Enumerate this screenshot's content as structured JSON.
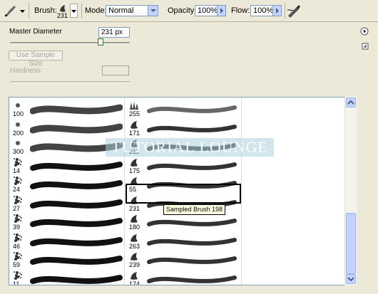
{
  "toolbar": {
    "tool_icon": "brush-tool-icon",
    "brush_label": "Brush:",
    "brush_size": "231",
    "mode_label": "Mode:",
    "mode_value": "Normal",
    "opacity_label": "Opacity:",
    "opacity_value": "100%",
    "flow_label": "Flow:",
    "flow_value": "100%",
    "airbrush_icon": "airbrush-icon"
  },
  "panel": {
    "master_diameter_label": "Master Diameter",
    "master_diameter_value": "231 px",
    "master_diameter_fraction": 0.78,
    "use_sample_size_label": "Use Sample Size",
    "hardness_label": "Hardness:",
    "menu_icon": "flyout-menu-icon",
    "new_preset_icon": "new-preset-icon"
  },
  "brushes": {
    "left_column": [
      {
        "num": "100",
        "tip": "soft"
      },
      {
        "num": "200",
        "tip": "soft"
      },
      {
        "num": "300",
        "tip": "soft"
      },
      {
        "num": "14",
        "tip": "splat"
      },
      {
        "num": "24",
        "tip": "splat"
      },
      {
        "num": "27",
        "tip": "splat"
      },
      {
        "num": "39",
        "tip": "splat"
      },
      {
        "num": "46",
        "tip": "splat"
      },
      {
        "num": "59",
        "tip": "splat"
      },
      {
        "num": "11",
        "tip": "splat"
      }
    ],
    "right_column": [
      {
        "num": "255",
        "tip": "grass"
      },
      {
        "num": "171",
        "tip": "leaf"
      },
      {
        "num": "212",
        "tip": "leaf"
      },
      {
        "num": "175",
        "tip": "leaf"
      },
      {
        "num": "55",
        "tip": "leaf"
      },
      {
        "num": "231",
        "tip": "leaf"
      },
      {
        "num": "180",
        "tip": "leaf"
      },
      {
        "num": "263",
        "tip": "leaf"
      },
      {
        "num": "239",
        "tip": "leaf"
      },
      {
        "num": "174",
        "tip": "leaf"
      }
    ]
  },
  "tooltip": "Sampled Brush 198",
  "watermark": "TUTORIAL LOUNGE",
  "colors": {
    "panel_bg": "#ece9d8",
    "accent": "#c3d3fd",
    "border": "#7f9db9"
  }
}
